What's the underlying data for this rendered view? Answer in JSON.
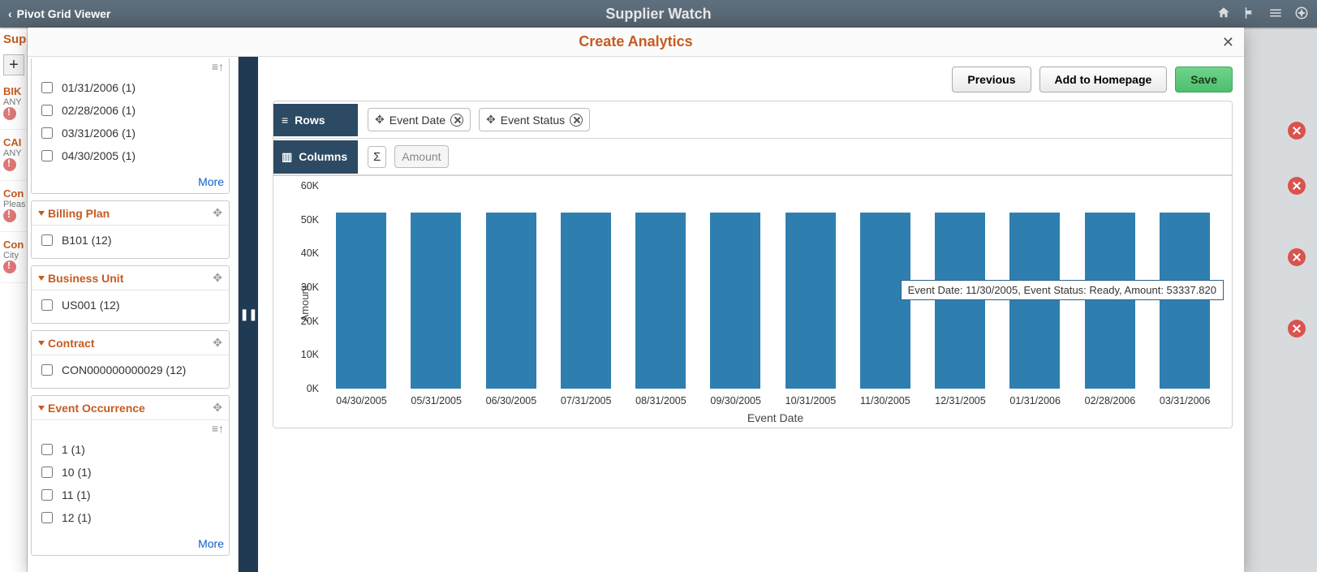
{
  "app_title": "Supplier Watch",
  "breadcrumb": {
    "back_label": "Pivot Grid Viewer"
  },
  "bg_page": {
    "header": "Supplier",
    "rows": [
      {
        "l1": "BIK",
        "l2": "ANY"
      },
      {
        "l1": "CAI",
        "l2": "ANY"
      },
      {
        "l1": "Con",
        "l2": "Pleas"
      },
      {
        "l1": "Con",
        "l2": "City"
      }
    ]
  },
  "modal": {
    "title": "Create Analytics",
    "buttons": {
      "prev": "Previous",
      "add_home": "Add to Homepage",
      "save": "Save"
    },
    "config": {
      "rows_label": "Rows",
      "columns_label": "Columns",
      "row_chips": [
        {
          "label": "Event Date"
        },
        {
          "label": "Event Status"
        }
      ],
      "col_chips": {
        "amount": "Amount"
      }
    }
  },
  "facets": {
    "event_date": {
      "title": "Event Date",
      "items": [
        "01/31/2006 (1)",
        "02/28/2006 (1)",
        "03/31/2006 (1)",
        "04/30/2005 (1)"
      ],
      "more": "More"
    },
    "billing_plan": {
      "title": "Billing Plan",
      "items": [
        "B101 (12)"
      ]
    },
    "business_unit": {
      "title": "Business Unit",
      "items": [
        "US001 (12)"
      ]
    },
    "contract": {
      "title": "Contract",
      "items": [
        "CON000000000029 (12)"
      ]
    },
    "event_occurrence": {
      "title": "Event Occurrence",
      "items": [
        "1 (1)",
        "10 (1)",
        "11 (1)",
        "12 (1)"
      ],
      "more": "More"
    }
  },
  "chart_data": {
    "type": "bar",
    "title": "",
    "xlabel": "Event Date",
    "ylabel": "Amount",
    "ylim": [
      0,
      60000
    ],
    "yticks_labels": [
      "0K",
      "10K",
      "20K",
      "30K",
      "40K",
      "50K",
      "60K"
    ],
    "categories": [
      "04/30/2005",
      "05/31/2005",
      "06/30/2005",
      "07/31/2005",
      "08/31/2005",
      "09/30/2005",
      "10/31/2005",
      "11/30/2005",
      "12/31/2005",
      "01/31/2006",
      "02/28/2006",
      "03/31/2006"
    ],
    "values": [
      53337.82,
      53337.82,
      53337.82,
      53337.82,
      53337.82,
      53337.82,
      53337.82,
      53337.82,
      53337.82,
      53337.82,
      53337.82,
      53337.82
    ],
    "tooltip": {
      "index": 7,
      "text": "Event Date: 11/30/2005, Event Status: Ready, Amount: 53337.820"
    }
  }
}
